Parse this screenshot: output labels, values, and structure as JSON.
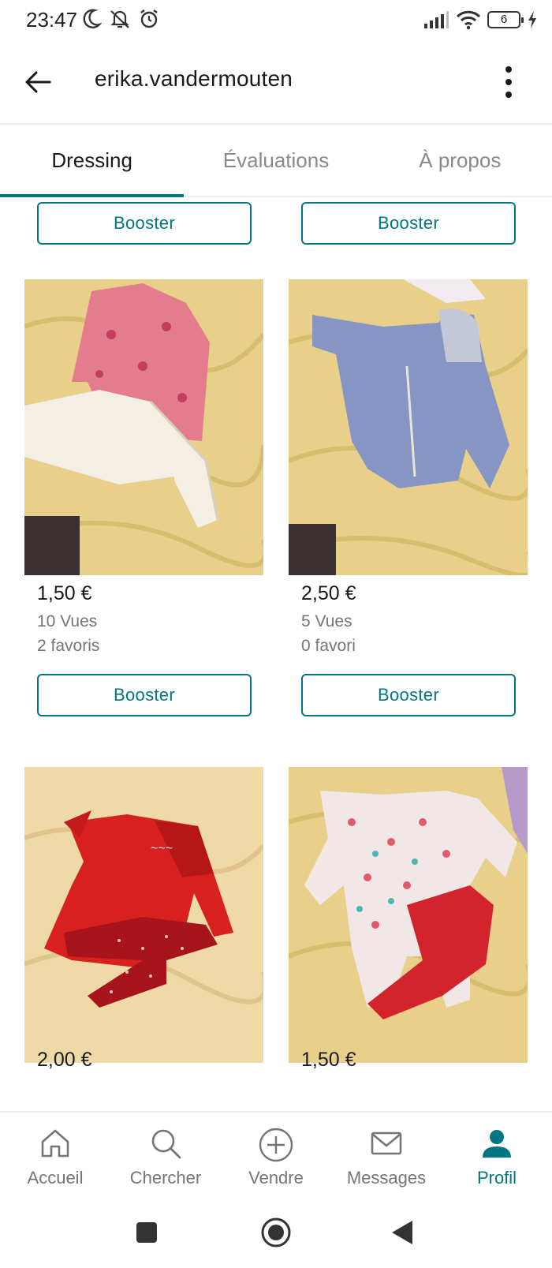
{
  "status_bar": {
    "time": "23:47",
    "battery": "6",
    "icons": [
      "moon-icon",
      "notifications-off-icon",
      "alarm-icon",
      "signal-icon",
      "wifi-icon",
      "battery-icon",
      "charging-icon"
    ]
  },
  "header": {
    "title": "erika.vandermouten",
    "back_icon": "arrow-left-icon",
    "more_icon": "more-vertical-icon"
  },
  "tabs": [
    {
      "label": "Dressing",
      "active": true
    },
    {
      "label": "Évaluations",
      "active": false
    },
    {
      "label": "À propos",
      "active": false
    }
  ],
  "booster_label": "Booster",
  "items": [
    {
      "price": "1,50 €",
      "views": "10 Vues",
      "favorites": "2 favoris",
      "photo": "pink-floral-dress-and-white-cardigan"
    },
    {
      "price": "2,50 €",
      "views": "5 Vues",
      "favorites": "0 favori",
      "photo": "blue-hooded-jacket"
    },
    {
      "price": "2,00 €",
      "photo": "red-dress-and-red-tights"
    },
    {
      "price": "1,50 €",
      "photo": "heart-print-pajamas-and-red-pants"
    }
  ],
  "bottom_nav": [
    {
      "label": "Accueil",
      "icon": "home-icon",
      "active": false
    },
    {
      "label": "Chercher",
      "icon": "search-icon",
      "active": false
    },
    {
      "label": "Vendre",
      "icon": "plus-circle-icon",
      "active": false
    },
    {
      "label": "Messages",
      "icon": "mail-icon",
      "active": false
    },
    {
      "label": "Profil",
      "icon": "user-icon",
      "active": true
    }
  ],
  "colors": {
    "accent": "#007782",
    "muted_text": "#757575",
    "photo_background": "#e8d08a"
  }
}
